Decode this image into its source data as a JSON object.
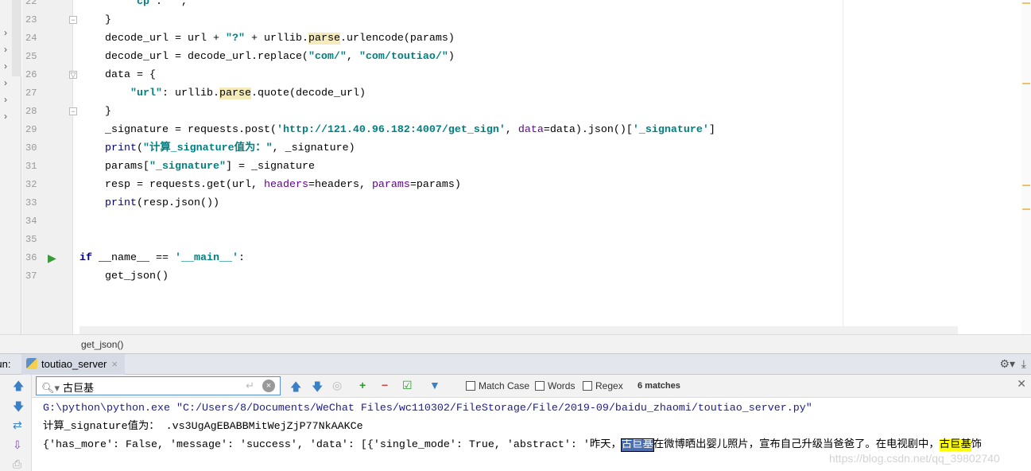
{
  "editor": {
    "first_line": 22,
    "lines": [
      [
        {
          "t": "        "
        },
        {
          "t": "\"cp\"",
          "c": "str"
        },
        {
          "t": ": "
        },
        {
          "t": "\"\"",
          "c": "str"
        },
        {
          "t": ","
        }
      ],
      [
        {
          "t": "    }"
        }
      ],
      [
        {
          "t": "    decode_url = url + "
        },
        {
          "t": "\"?\"",
          "c": "str"
        },
        {
          "t": " + urllib."
        },
        {
          "t": "parse",
          "c": "hl"
        },
        {
          "t": ".urlencode(params)"
        }
      ],
      [
        {
          "t": "    decode_url = decode_url.replace("
        },
        {
          "t": "\"com/\"",
          "c": "str"
        },
        {
          "t": ", "
        },
        {
          "t": "\"com/toutiao/\"",
          "c": "str"
        },
        {
          "t": ")"
        }
      ],
      [
        {
          "t": "    data = {"
        }
      ],
      [
        {
          "t": "        "
        },
        {
          "t": "\"url\"",
          "c": "str"
        },
        {
          "t": ": urllib."
        },
        {
          "t": "parse",
          "c": "hl"
        },
        {
          "t": ".quote(decode_url)"
        }
      ],
      [
        {
          "t": "    }"
        }
      ],
      [
        {
          "t": "    _signature = requests.post("
        },
        {
          "t": "'http://121.40.96.182:4007/get_sign'",
          "c": "str"
        },
        {
          "t": ", "
        },
        {
          "t": "data",
          "c": "par"
        },
        {
          "t": "=data).json()["
        },
        {
          "t": "'_signature'",
          "c": "str"
        },
        {
          "t": "]"
        }
      ],
      [
        {
          "t": "    "
        },
        {
          "t": "print",
          "c": "bi"
        },
        {
          "t": "("
        },
        {
          "t": "\"计算_signature值为：\"",
          "c": "str"
        },
        {
          "t": ", _signature)"
        }
      ],
      [
        {
          "t": "    params["
        },
        {
          "t": "\"_signature\"",
          "c": "str"
        },
        {
          "t": "] = _signature"
        }
      ],
      [
        {
          "t": "    resp = requests.get(url, "
        },
        {
          "t": "headers",
          "c": "par"
        },
        {
          "t": "=headers, "
        },
        {
          "t": "params",
          "c": "par"
        },
        {
          "t": "=params)"
        }
      ],
      [
        {
          "t": "    "
        },
        {
          "t": "print",
          "c": "bi"
        },
        {
          "t": "(resp.json())"
        }
      ],
      [
        {
          "t": ""
        }
      ],
      [
        {
          "t": ""
        }
      ],
      [
        {
          "t": "if",
          "c": "kw"
        },
        {
          "t": " __name__ == "
        },
        {
          "t": "'__main__'",
          "c": "str"
        },
        {
          "t": ":"
        }
      ],
      [
        {
          "t": "    get_json()"
        }
      ]
    ]
  },
  "breadcrumb": "get_json()",
  "run": {
    "label": "Run:",
    "tab": "toutiao_server"
  },
  "search": {
    "query": "古巨基",
    "options": [
      "Match Case",
      "Words",
      "Regex"
    ],
    "matches": "6 matches"
  },
  "output": {
    "cmd": "G:\\python\\python.exe \"C:/Users/8/Documents/WeChat Files/wc110302/FileStorage/File/2019-09/baidu_zhaomi/toutiao_server.py\"",
    "sig": "计算_signature值为： .vs3UgAgEBABBMitWejZjP77NkAAKCe",
    "json_pre": "{'has_more': False, 'message': 'success', 'data': [{'single_mode': True, 'abstract': '昨天，",
    "match1": "古巨基",
    "json_mid": "在微博晒出婴儿照片，宣布自己升级当爸爸了。在电视剧中，",
    "match2": "古巨基",
    "json_post": "饰"
  },
  "watermark": "https://blog.csdn.net/qq_39802740"
}
